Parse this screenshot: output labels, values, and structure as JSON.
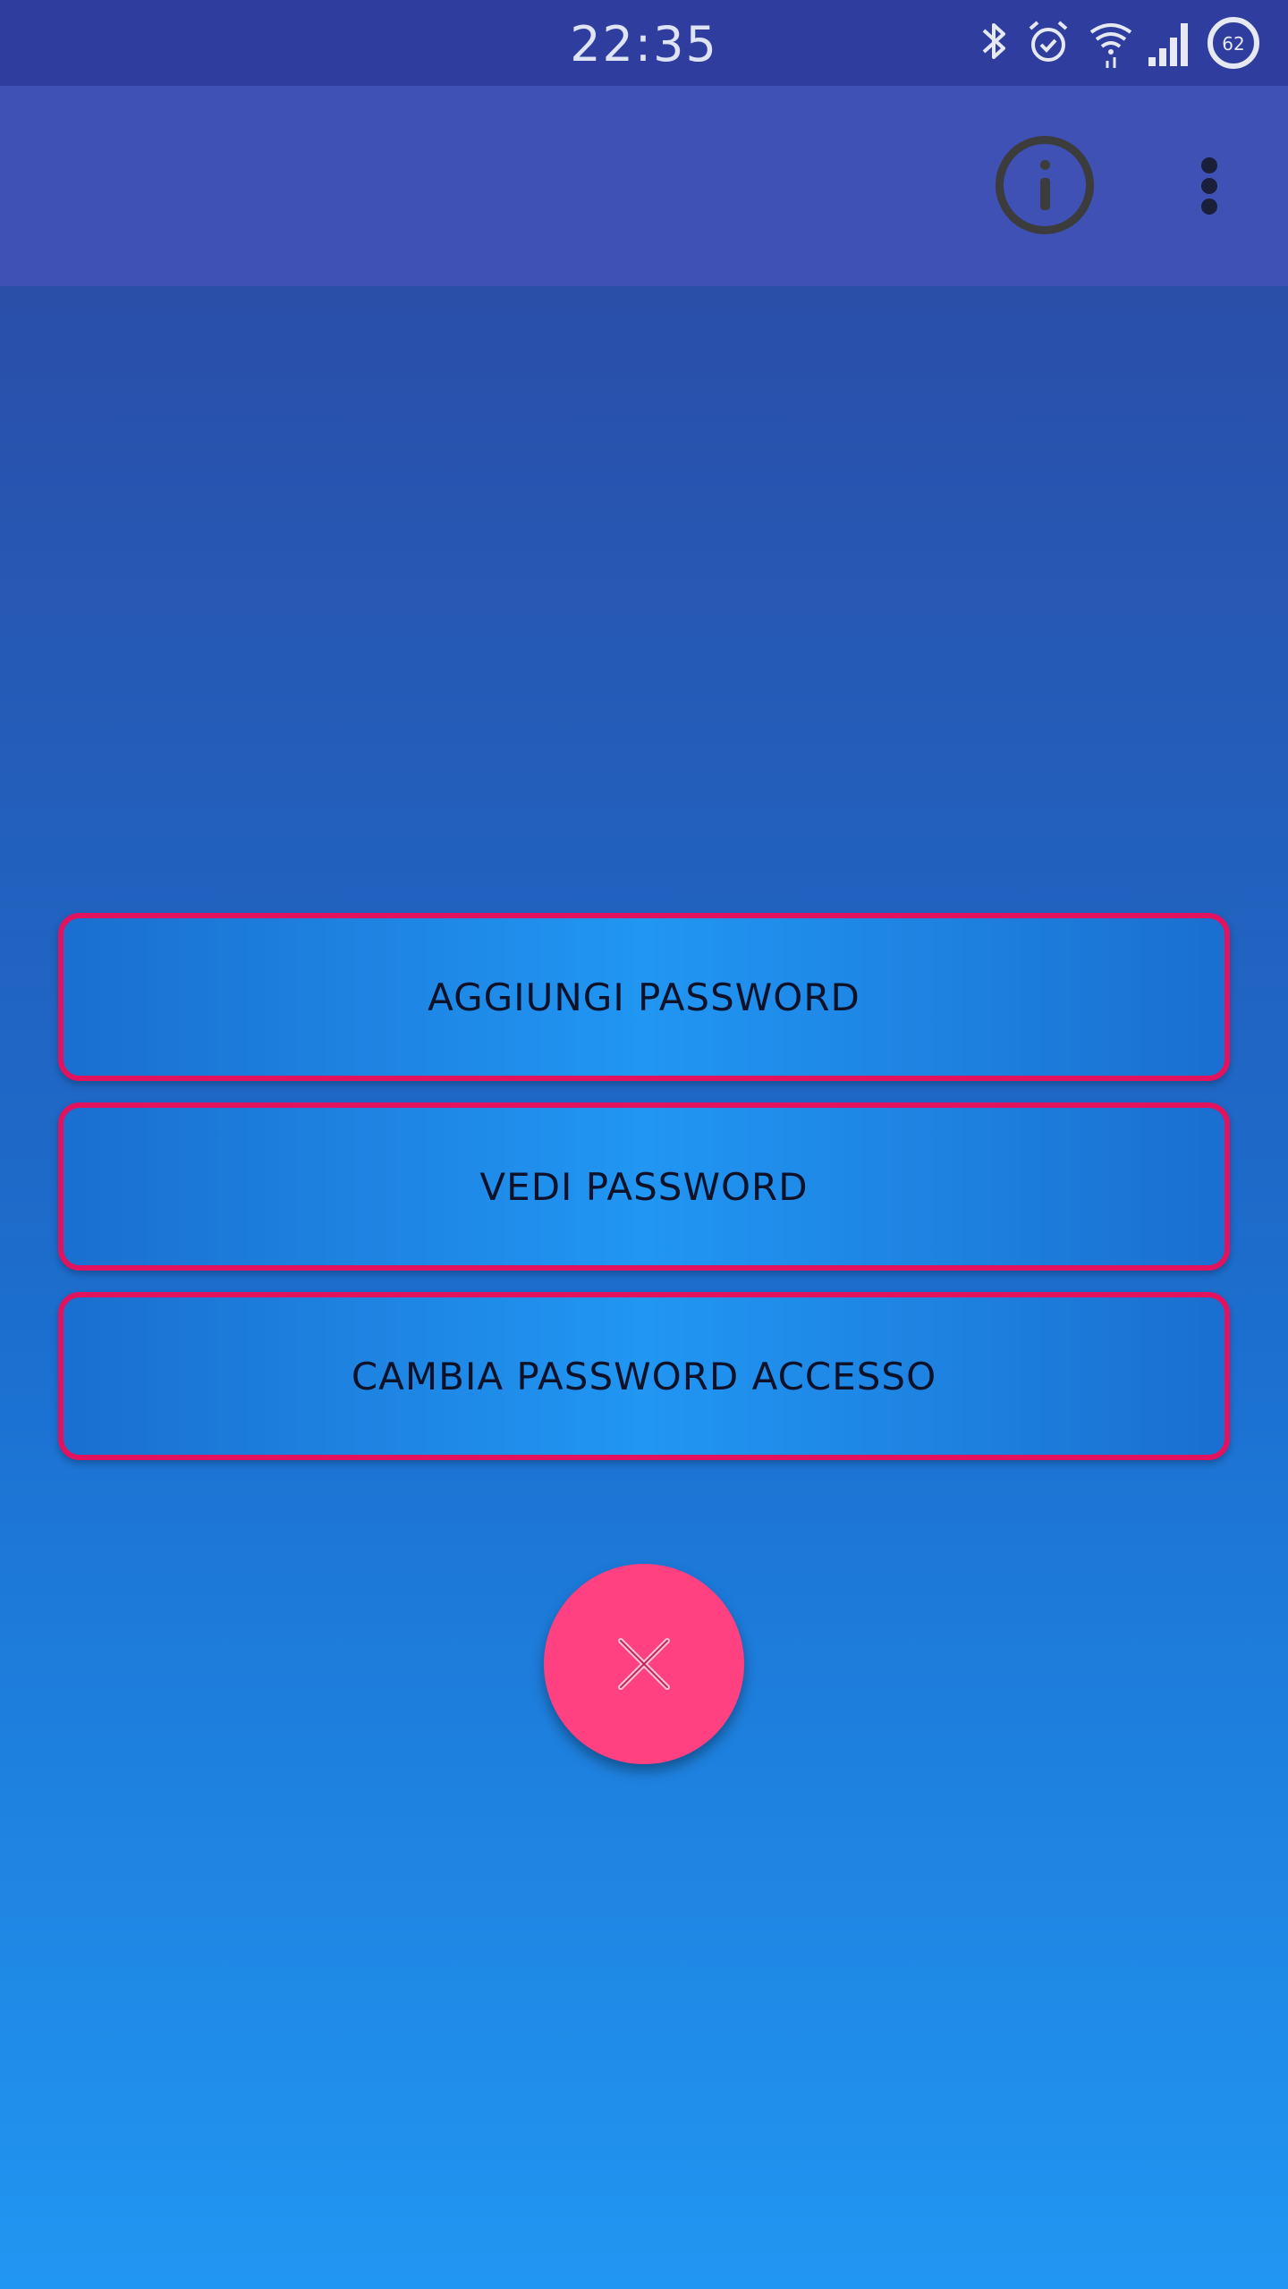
{
  "status_bar": {
    "time": "22:35",
    "battery_level": "62",
    "icons": [
      "bluetooth-icon",
      "alarm-icon",
      "wifi-icon",
      "signal-icon",
      "battery-icon"
    ]
  },
  "toolbar": {
    "icons": [
      "info-icon",
      "overflow-menu-icon"
    ]
  },
  "actions": [
    {
      "label": "AGGIUNGI PASSWORD"
    },
    {
      "label": "VEDI PASSWORD"
    },
    {
      "label": "CAMBIA PASSWORD ACCESSO"
    }
  ],
  "fab": {
    "icon": "close-icon"
  },
  "colors": {
    "status_bar": "#2f3e9e",
    "toolbar": "#3f51b5",
    "button_border": "#e2125e",
    "fab": "#ff4081"
  }
}
